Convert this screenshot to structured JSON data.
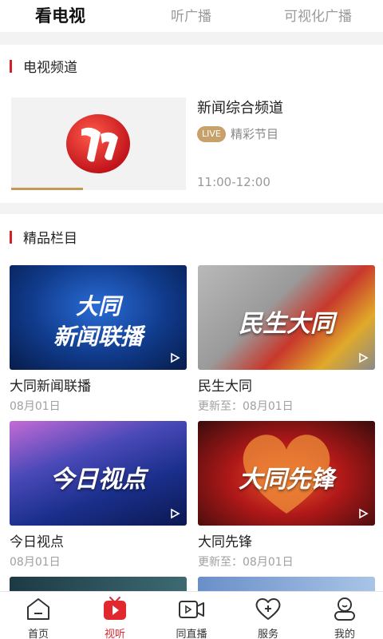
{
  "top_tabs": [
    {
      "label": "看电视",
      "active": true
    },
    {
      "label": "听广播",
      "active": false
    },
    {
      "label": "可视化广播",
      "active": false
    }
  ],
  "tv_section": {
    "title": "电视频道",
    "channel": {
      "name": "新闻综合频道",
      "badge": "LIVE",
      "program": "精彩节目",
      "time": "11:00-12:00",
      "progress": 0.41
    }
  },
  "featured_section": {
    "title": "精品栏目",
    "items": [
      {
        "thumb_text": [
          "大同",
          "新闻联播"
        ],
        "title": "大同新闻联播",
        "date": "08月01日"
      },
      {
        "thumb_text": [
          "民生大同"
        ],
        "title": "民生大同",
        "date": "更新至：08月01日"
      },
      {
        "thumb_text": [
          "今日视点"
        ],
        "title": "今日视点",
        "date": "08月01日"
      },
      {
        "thumb_text": [
          "大同先锋"
        ],
        "title": "大同先锋",
        "date": "更新至：08月01日"
      }
    ]
  },
  "bottom_nav": [
    {
      "label": "首页",
      "icon": "home-icon",
      "active": false
    },
    {
      "label": "视听",
      "icon": "tv-icon",
      "active": true
    },
    {
      "label": "同直播",
      "icon": "video-camera-icon",
      "active": false
    },
    {
      "label": "服务",
      "icon": "heart-plus-icon",
      "active": false
    },
    {
      "label": "我的",
      "icon": "user-icon",
      "active": false
    }
  ],
  "colors": {
    "accent": "#d81e28",
    "badge": "#c7a169"
  }
}
